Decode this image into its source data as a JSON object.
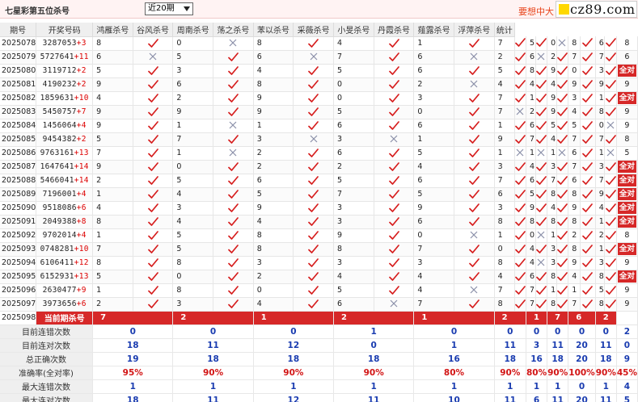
{
  "header": {
    "title": "七星彩第五位杀号",
    "select_value": "近20期",
    "promo": "要想中大",
    "logo_text": "cz89.com"
  },
  "columns": [
    "期号",
    "开奖号码",
    "鸿雁杀号",
    "谷风杀号",
    "周南杀号",
    "荡之杀号",
    "苯以杀号",
    "采薇杀号",
    "小旻杀号",
    "丹霞杀号",
    "薤露杀号",
    "浮萍杀号",
    "统计"
  ],
  "rows": [
    {
      "p": "2025078",
      "n": "3287053",
      "s": "+3",
      "k": [
        [
          "8",
          "c"
        ],
        [
          "0",
          "x"
        ],
        [
          "8",
          "c"
        ],
        [
          "4",
          "c"
        ],
        [
          "1",
          "c"
        ],
        [
          "7",
          "c"
        ],
        [
          "5",
          "c"
        ],
        [
          "0",
          "x"
        ],
        [
          "8",
          "c"
        ],
        [
          "6",
          "c"
        ]
      ],
      "t": "8"
    },
    {
      "p": "2025079",
      "n": "5727641",
      "s": "+11",
      "k": [
        [
          "6",
          "x"
        ],
        [
          "5",
          "c"
        ],
        [
          "6",
          "x"
        ],
        [
          "7",
          "c"
        ],
        [
          "6",
          "x"
        ],
        [
          "2",
          "c"
        ],
        [
          "6",
          "x"
        ],
        [
          "2",
          "c"
        ],
        [
          "7",
          "c"
        ],
        [
          "7",
          "c"
        ]
      ],
      "t": "6"
    },
    {
      "p": "2025080",
      "n": "3119712",
      "s": "+2",
      "k": [
        [
          "5",
          "c"
        ],
        [
          "3",
          "c"
        ],
        [
          "4",
          "c"
        ],
        [
          "5",
          "c"
        ],
        [
          "6",
          "c"
        ],
        [
          "5",
          "c"
        ],
        [
          "8",
          "c"
        ],
        [
          "9",
          "c"
        ],
        [
          "0",
          "c"
        ],
        [
          "3",
          "c"
        ]
      ],
      "t": "全对"
    },
    {
      "p": "2025081",
      "n": "4190232",
      "s": "+2",
      "k": [
        [
          "9",
          "c"
        ],
        [
          "6",
          "c"
        ],
        [
          "8",
          "c"
        ],
        [
          "0",
          "c"
        ],
        [
          "2",
          "x"
        ],
        [
          "4",
          "c"
        ],
        [
          "4",
          "c"
        ],
        [
          "4",
          "c"
        ],
        [
          "9",
          "c"
        ],
        [
          "9",
          "c"
        ]
      ],
      "t": "9"
    },
    {
      "p": "2025082",
      "n": "1859631",
      "s": "+10",
      "k": [
        [
          "4",
          "c"
        ],
        [
          "2",
          "c"
        ],
        [
          "9",
          "c"
        ],
        [
          "0",
          "c"
        ],
        [
          "3",
          "c"
        ],
        [
          "7",
          "c"
        ],
        [
          "1",
          "c"
        ],
        [
          "9",
          "c"
        ],
        [
          "3",
          "c"
        ],
        [
          "1",
          "c"
        ]
      ],
      "t": "全对"
    },
    {
      "p": "2025083",
      "n": "5450757",
      "s": "+7",
      "k": [
        [
          "9",
          "c"
        ],
        [
          "9",
          "c"
        ],
        [
          "9",
          "c"
        ],
        [
          "5",
          "c"
        ],
        [
          "0",
          "c"
        ],
        [
          "7",
          "x"
        ],
        [
          "2",
          "c"
        ],
        [
          "9",
          "c"
        ],
        [
          "4",
          "c"
        ],
        [
          "8",
          "c"
        ]
      ],
      "t": "9"
    },
    {
      "p": "2025084",
      "n": "1456064",
      "s": "+4",
      "k": [
        [
          "9",
          "c"
        ],
        [
          "1",
          "x"
        ],
        [
          "1",
          "c"
        ],
        [
          "6",
          "c"
        ],
        [
          "6",
          "c"
        ],
        [
          "1",
          "c"
        ],
        [
          "6",
          "c"
        ],
        [
          "5",
          "c"
        ],
        [
          "5",
          "c"
        ],
        [
          "0",
          "x"
        ]
      ],
      "t": "9"
    },
    {
      "p": "2025085",
      "n": "9454382",
      "s": "+2",
      "k": [
        [
          "5",
          "c"
        ],
        [
          "7",
          "c"
        ],
        [
          "3",
          "x"
        ],
        [
          "3",
          "x"
        ],
        [
          "1",
          "c"
        ],
        [
          "9",
          "c"
        ],
        [
          "7",
          "c"
        ],
        [
          "4",
          "c"
        ],
        [
          "7",
          "c"
        ],
        [
          "7",
          "c"
        ]
      ],
      "t": "8"
    },
    {
      "p": "2025086",
      "n": "9763161",
      "s": "+13",
      "k": [
        [
          "7",
          "c"
        ],
        [
          "1",
          "x"
        ],
        [
          "2",
          "c"
        ],
        [
          "6",
          "c"
        ],
        [
          "5",
          "c"
        ],
        [
          "1",
          "x"
        ],
        [
          "1",
          "x"
        ],
        [
          "1",
          "x"
        ],
        [
          "6",
          "c"
        ],
        [
          "1",
          "x"
        ]
      ],
      "t": "5"
    },
    {
      "p": "2025087",
      "n": "1647641",
      "s": "+14",
      "k": [
        [
          "9",
          "c"
        ],
        [
          "0",
          "c"
        ],
        [
          "2",
          "c"
        ],
        [
          "2",
          "c"
        ],
        [
          "4",
          "c"
        ],
        [
          "3",
          "c"
        ],
        [
          "4",
          "c"
        ],
        [
          "3",
          "c"
        ],
        [
          "7",
          "c"
        ],
        [
          "3",
          "c"
        ]
      ],
      "t": "全对"
    },
    {
      "p": "2025088",
      "n": "5466041",
      "s": "+14",
      "k": [
        [
          "2",
          "c"
        ],
        [
          "5",
          "c"
        ],
        [
          "6",
          "c"
        ],
        [
          "5",
          "c"
        ],
        [
          "6",
          "c"
        ],
        [
          "7",
          "c"
        ],
        [
          "6",
          "c"
        ],
        [
          "7",
          "c"
        ],
        [
          "6",
          "c"
        ],
        [
          "7",
          "c"
        ]
      ],
      "t": "全对"
    },
    {
      "p": "2025089",
      "n": "7196001",
      "s": "+4",
      "k": [
        [
          "1",
          "c"
        ],
        [
          "4",
          "c"
        ],
        [
          "5",
          "c"
        ],
        [
          "7",
          "c"
        ],
        [
          "5",
          "c"
        ],
        [
          "6",
          "c"
        ],
        [
          "5",
          "c"
        ],
        [
          "8",
          "c"
        ],
        [
          "8",
          "c"
        ],
        [
          "9",
          "c"
        ]
      ],
      "t": "全对"
    },
    {
      "p": "2025090",
      "n": "9518086",
      "s": "+6",
      "k": [
        [
          "4",
          "c"
        ],
        [
          "3",
          "c"
        ],
        [
          "9",
          "c"
        ],
        [
          "3",
          "c"
        ],
        [
          "9",
          "c"
        ],
        [
          "3",
          "c"
        ],
        [
          "9",
          "c"
        ],
        [
          "4",
          "c"
        ],
        [
          "9",
          "c"
        ],
        [
          "4",
          "c"
        ]
      ],
      "t": "全对"
    },
    {
      "p": "2025091",
      "n": "2049388",
      "s": "+8",
      "k": [
        [
          "8",
          "c"
        ],
        [
          "4",
          "c"
        ],
        [
          "4",
          "c"
        ],
        [
          "3",
          "c"
        ],
        [
          "6",
          "c"
        ],
        [
          "8",
          "c"
        ],
        [
          "8",
          "c"
        ],
        [
          "8",
          "c"
        ],
        [
          "8",
          "c"
        ],
        [
          "1",
          "c"
        ]
      ],
      "t": "全对"
    },
    {
      "p": "2025092",
      "n": "9702014",
      "s": "+4",
      "k": [
        [
          "1",
          "c"
        ],
        [
          "5",
          "c"
        ],
        [
          "8",
          "c"
        ],
        [
          "9",
          "c"
        ],
        [
          "0",
          "x"
        ],
        [
          "1",
          "c"
        ],
        [
          "0",
          "x"
        ],
        [
          "1",
          "c"
        ],
        [
          "2",
          "c"
        ],
        [
          "2",
          "c"
        ]
      ],
      "t": "8"
    },
    {
      "p": "2025093",
      "n": "0748281",
      "s": "+10",
      "k": [
        [
          "7",
          "c"
        ],
        [
          "5",
          "c"
        ],
        [
          "8",
          "c"
        ],
        [
          "8",
          "c"
        ],
        [
          "7",
          "c"
        ],
        [
          "0",
          "c"
        ],
        [
          "4",
          "c"
        ],
        [
          "3",
          "c"
        ],
        [
          "8",
          "c"
        ],
        [
          "1",
          "c"
        ]
      ],
      "t": "全对"
    },
    {
      "p": "2025094",
      "n": "6106411",
      "s": "+12",
      "k": [
        [
          "8",
          "c"
        ],
        [
          "8",
          "c"
        ],
        [
          "3",
          "c"
        ],
        [
          "3",
          "c"
        ],
        [
          "3",
          "c"
        ],
        [
          "8",
          "c"
        ],
        [
          "4",
          "x"
        ],
        [
          "3",
          "c"
        ],
        [
          "9",
          "c"
        ],
        [
          "3",
          "c"
        ]
      ],
      "t": "9"
    },
    {
      "p": "2025095",
      "n": "6152931",
      "s": "+13",
      "k": [
        [
          "5",
          "c"
        ],
        [
          "0",
          "c"
        ],
        [
          "2",
          "c"
        ],
        [
          "4",
          "c"
        ],
        [
          "4",
          "c"
        ],
        [
          "4",
          "c"
        ],
        [
          "6",
          "c"
        ],
        [
          "8",
          "c"
        ],
        [
          "4",
          "c"
        ],
        [
          "8",
          "c"
        ]
      ],
      "t": "全对"
    },
    {
      "p": "2025096",
      "n": "2630477",
      "s": "+9",
      "k": [
        [
          "1",
          "c"
        ],
        [
          "8",
          "c"
        ],
        [
          "0",
          "c"
        ],
        [
          "5",
          "c"
        ],
        [
          "4",
          "x"
        ],
        [
          "7",
          "c"
        ],
        [
          "7",
          "c"
        ],
        [
          "1",
          "c"
        ],
        [
          "1",
          "c"
        ],
        [
          "5",
          "c"
        ]
      ],
      "t": "9"
    },
    {
      "p": "2025097",
      "n": "3973656",
      "s": "+6",
      "k": [
        [
          "2",
          "c"
        ],
        [
          "3",
          "c"
        ],
        [
          "4",
          "c"
        ],
        [
          "6",
          "x"
        ],
        [
          "7",
          "c"
        ],
        [
          "8",
          "c"
        ],
        [
          "7",
          "c"
        ],
        [
          "8",
          "c"
        ],
        [
          "7",
          "c"
        ],
        [
          "8",
          "c"
        ]
      ],
      "t": "9"
    }
  ],
  "current": {
    "p": "2025098",
    "label": "当前期杀号",
    "vals": [
      "7",
      "2",
      "1",
      "2",
      "1",
      "2",
      "1",
      "7",
      "6",
      "2"
    ]
  },
  "stats": [
    {
      "label": "目前连错次数",
      "vals": [
        "0",
        "0",
        "0",
        "1",
        "0",
        "0",
        "0",
        "0",
        "0",
        "0",
        "2"
      ]
    },
    {
      "label": "目前连对次数",
      "vals": [
        "18",
        "11",
        "12",
        "0",
        "1",
        "11",
        "3",
        "11",
        "20",
        "11",
        "0"
      ]
    },
    {
      "label": "总正确次数",
      "vals": [
        "19",
        "18",
        "18",
        "18",
        "16",
        "18",
        "16",
        "18",
        "20",
        "18",
        "9"
      ]
    },
    {
      "label": "准确率(全对率)",
      "vals": [
        "95%",
        "90%",
        "90%",
        "90%",
        "80%",
        "90%",
        "80%",
        "90%",
        "100%",
        "90%",
        "45%"
      ],
      "rate": true
    },
    {
      "label": "最大连错次数",
      "vals": [
        "1",
        "1",
        "1",
        "1",
        "1",
        "1",
        "1",
        "1",
        "0",
        "1",
        "4"
      ]
    },
    {
      "label": "最大连对次数",
      "vals": [
        "18",
        "11",
        "12",
        "11",
        "10",
        "11",
        "6",
        "11",
        "20",
        "11",
        "5"
      ]
    }
  ],
  "colors": {
    "accent": "#d62828",
    "check": "#d61e1e",
    "cross": "#8a8fa8",
    "stat_blue": "#1a3cb0"
  }
}
